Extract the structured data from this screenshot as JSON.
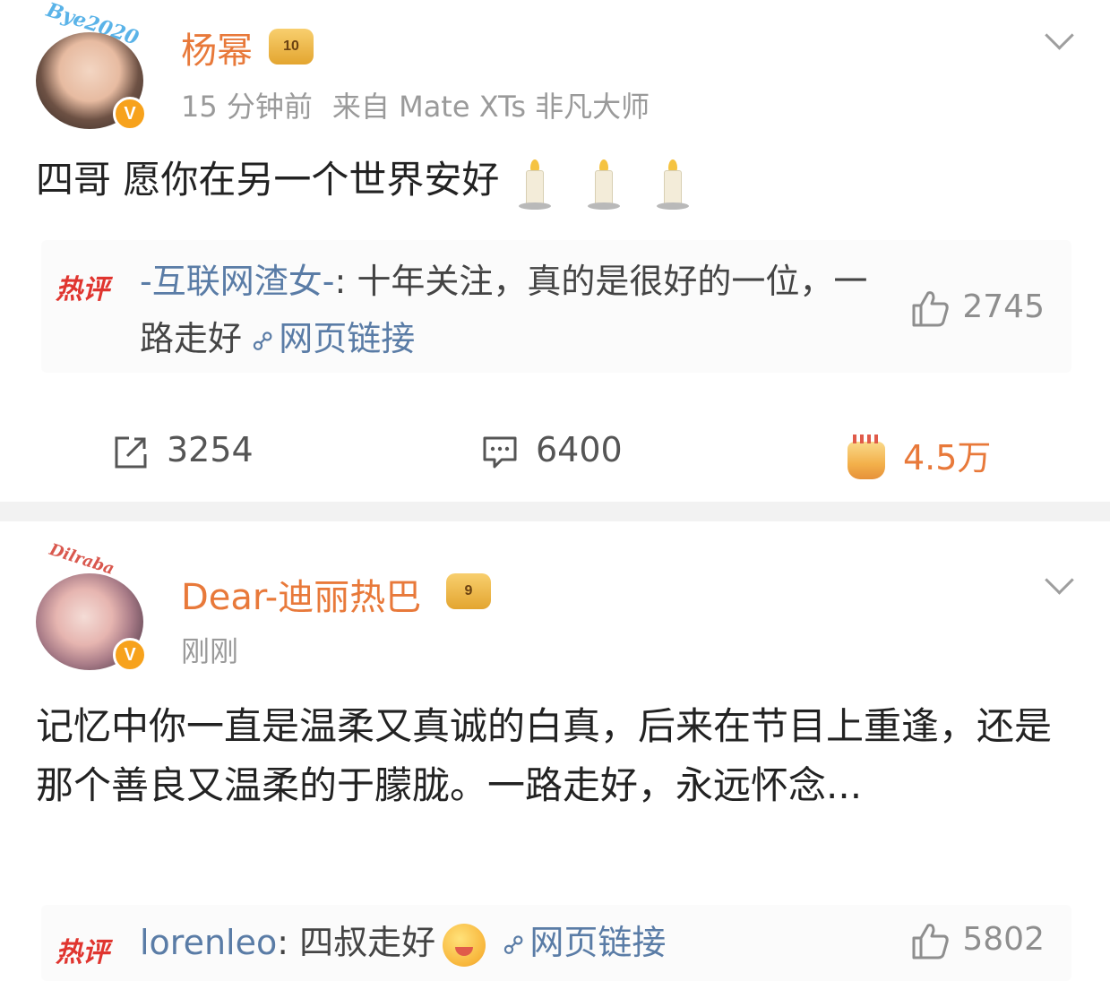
{
  "posts": [
    {
      "author": "杨幂",
      "avatar_decor_text": "Bye2020",
      "verified_badge": "V",
      "crown_badge": "10",
      "time": "15 分钟前",
      "source": "来自 Mate XTs 非凡大师",
      "content": "四哥 愿你在另一个世界安好",
      "hot_comment": {
        "tag": "热评",
        "user": "-互联网渣女-",
        "text": "十年关注，真的是很好的一位，一路走好",
        "link_label": "网页链接",
        "likes": "2745"
      },
      "actions": {
        "reposts": "3254",
        "comments": "6400",
        "likes": "4.5万"
      }
    },
    {
      "author": "Dear-迪丽热巴",
      "avatar_decor_text": "Dilraba",
      "verified_badge": "V",
      "crown_badge": "9",
      "time": "刚刚",
      "content": "记忆中你一直是温柔又真诚的白真，后来在节目上重逢，还是那个善良又温柔的于朦胧。一路走好，永远怀念...",
      "hot_comment": {
        "tag": "热评",
        "user": "lorenleo",
        "text": "四叔走好",
        "link_label": "网页链接",
        "likes": "5802"
      }
    }
  ],
  "colors": {
    "name": "#e8793a",
    "meta": "#9a9a9a",
    "hot_tag": "#e0352f",
    "link": "#5a7ca6",
    "separator": "#f2f2f2"
  }
}
